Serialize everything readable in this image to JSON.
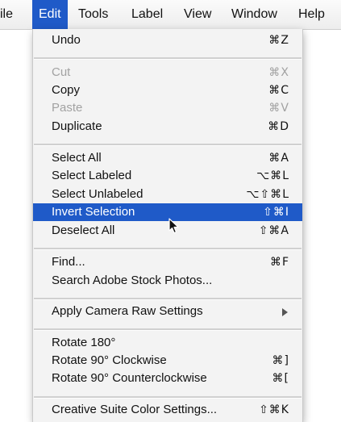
{
  "menubar": {
    "items": [
      {
        "label": "ile"
      },
      {
        "label": "Edit"
      },
      {
        "label": "Tools"
      },
      {
        "label": "Label"
      },
      {
        "label": "View"
      },
      {
        "label": "Window"
      },
      {
        "label": "Help"
      }
    ]
  },
  "menu": {
    "items": [
      {
        "label": "Undo",
        "shortcut": "⌘Z"
      },
      {
        "label": "Cut",
        "shortcut": "⌘X"
      },
      {
        "label": "Copy",
        "shortcut": "⌘C"
      },
      {
        "label": "Paste",
        "shortcut": "⌘V"
      },
      {
        "label": "Duplicate",
        "shortcut": "⌘D"
      },
      {
        "label": "Select All",
        "shortcut": "⌘A"
      },
      {
        "label": "Select Labeled",
        "shortcut": "⌥⌘L"
      },
      {
        "label": "Select Unlabeled",
        "shortcut": "⌥⇧⌘L"
      },
      {
        "label": "Invert Selection",
        "shortcut": "⇧⌘I"
      },
      {
        "label": "Deselect All",
        "shortcut": "⇧⌘A"
      },
      {
        "label": "Find...",
        "shortcut": "⌘F"
      },
      {
        "label": "Search Adobe Stock Photos...",
        "shortcut": ""
      },
      {
        "label": "Apply Camera Raw Settings",
        "shortcut": ""
      },
      {
        "label": "Rotate 180°",
        "shortcut": ""
      },
      {
        "label": "Rotate 90° Clockwise",
        "shortcut": "⌘]"
      },
      {
        "label": "Rotate 90° Counterclockwise",
        "shortcut": "⌘["
      },
      {
        "label": "Creative Suite Color Settings...",
        "shortcut": "⇧⌘K"
      }
    ]
  },
  "colors": {
    "highlight": "#1f5ac8",
    "menu_background": "#f3f3f3",
    "disabled_text": "#a2a2a2"
  }
}
